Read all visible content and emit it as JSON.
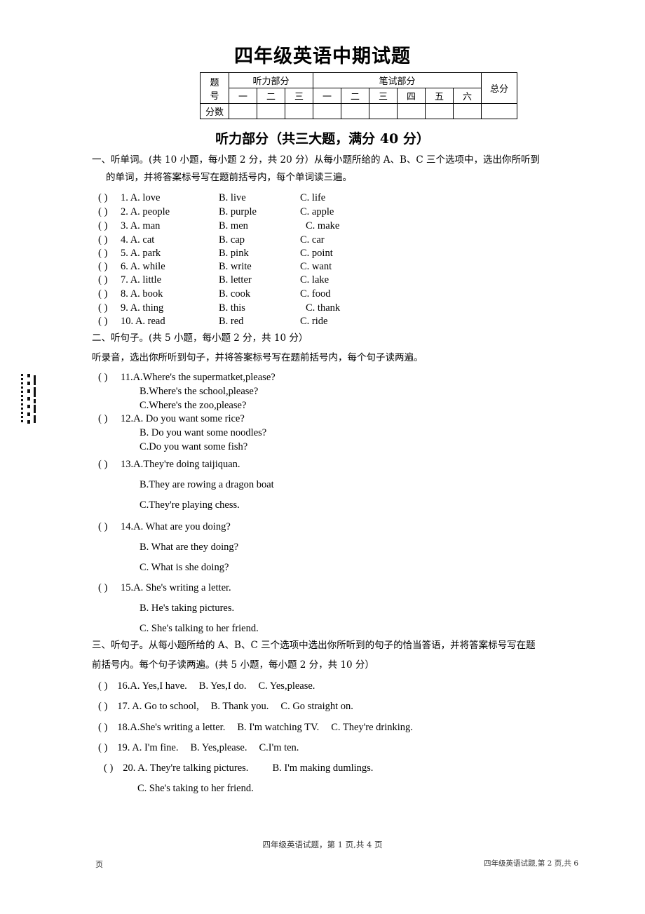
{
  "document": {
    "title": "四年级英语中期试题"
  },
  "score_table": {
    "row_label_1": "题",
    "row_label_1b": "号",
    "row_label_2": "分数",
    "group_listening": "听力部分",
    "group_written": "笔试部分",
    "group_total": "总分",
    "listening_numbers": [
      "一",
      "二",
      "三"
    ],
    "written_numbers": [
      "一",
      "二",
      "三",
      "四",
      "五",
      "六"
    ]
  },
  "listening_section": {
    "heading": "听力部分（共三大题，满分 40 分）"
  },
  "part1": {
    "instruction_line1": "一、听单词。(共 10 小题，每小题 2 分，共 20 分）从每小题所给的 A、B、C 三个选项中，选出你所听到",
    "instruction_line2": "的单词，并将答案标号写在题前括号内，每个单词读三遍。",
    "items": [
      {
        "paren": "(      )",
        "a": "1. A. love",
        "b": "B. live",
        "c": "C. life"
      },
      {
        "paren": "(      )",
        "a": "2. A. people",
        "b": "B. purple",
        "c": "C. apple"
      },
      {
        "paren": "(      )",
        "a": "3. A. man",
        "b": "B. men",
        "c": "C. make"
      },
      {
        "paren": "(      )",
        "a": "4. A. cat",
        "b": "B. cap",
        "c": "C. car"
      },
      {
        "paren": "(      )",
        "a": "5. A. park",
        "b": "B. pink",
        "c": "C. point"
      },
      {
        "paren": "(      )",
        "a": "6. A. while",
        "b": "B. write",
        "c": "C. want"
      },
      {
        "paren": "(      )",
        "a": "7. A. little",
        "b": "B. letter",
        "c": "C. lake"
      },
      {
        "paren": "(      )",
        "a": "8. A. book",
        "b": "B. cook",
        "c": "C. food"
      },
      {
        "paren": "(      )",
        "a": "9. A. thing",
        "b": "B. this",
        "c": "C. thank"
      },
      {
        "paren": "(      )",
        "a": "10. A. read",
        "b": "B. red",
        "c": "C. ride"
      }
    ]
  },
  "part2": {
    "instruction_line1": "二、听句子。(共 5 小题，每小题 2 分，共 10 分）",
    "instruction_line2": "听录音，选出你所听到句子，并将答案标号写在题前括号内，每个句子读两遍。",
    "items": [
      {
        "paren": "(      )",
        "lines": [
          "11.A.Where's the supermatket,please?",
          "B.Where's the school,please?",
          "C.Where's the zoo,please?"
        ]
      },
      {
        "paren": "(      )",
        "lines": [
          "12.A. Do you want some rice?",
          "B. Do you want some noodles?",
          "C.Do you want some fish?"
        ]
      },
      {
        "paren": "(      )",
        "lines": [
          "13.A.They're doing taijiquan.",
          "B.They are rowing a dragon boat",
          "C.They're playing chess."
        ]
      },
      {
        "paren": "(      )",
        "lines": [
          "14.A. What are you doing?",
          "B. What are they doing?",
          "C. What is she doing?"
        ]
      },
      {
        "paren": "(      )",
        "lines": [
          "15.A. She's writing a letter.",
          "B. He's taking pictures.",
          "C. She's talking to her friend."
        ]
      }
    ]
  },
  "part3": {
    "instruction_line1": "三、听句子。从每小题所给的 A、B、C 三个选项中选出你所听到的句子的恰当答语，并将答案标号写在题",
    "instruction_line2": "前括号内。每个句子读两遍。(共 5 小题，每小题 2 分，共 10 分）",
    "items": [
      {
        "paren": "(      )",
        "a": "16.A. Yes,I have.",
        "b": "B. Yes,I do.",
        "c": "C. Yes,please."
      },
      {
        "paren": "(      )",
        "a": "17. A. Go to school,",
        "b": "B. Thank you.",
        "c": "C. Go straight on."
      },
      {
        "paren": "(      )",
        "a": "18.A.She's writing a letter.",
        "b": "B. I'm watching TV.",
        "c": "C. They're drinking."
      },
      {
        "paren": "(      )",
        "a": "19. A. I'm fine.",
        "b": "B. Yes,please.",
        "c": "C.I'm ten."
      },
      {
        "paren": "(      )",
        "a": "20. A. They're talking pictures.",
        "b": "B. I'm making dumlings.",
        "c": ""
      }
    ],
    "item20_line2": "C. She's taking to her friend."
  },
  "footers": {
    "center": "四年级英语试题，第 1 页,共 4 页",
    "right": "四年级英语试题,第 2 页,共 6",
    "left_char": "页"
  }
}
